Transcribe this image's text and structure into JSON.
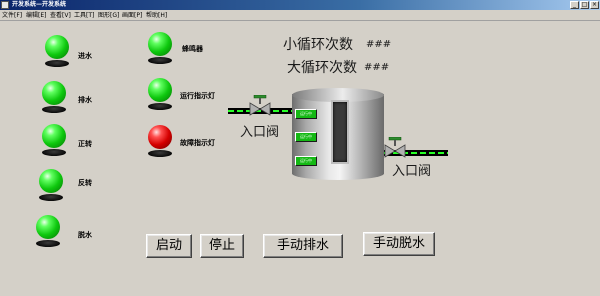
{
  "window": {
    "title": "开发系统—开发系统"
  },
  "menu": [
    "文件[F]",
    "编辑[E]",
    "查看[V]",
    "工具[T]",
    "图形[G]",
    "画面[P]",
    "帮助[H]"
  ],
  "counters": {
    "small_cycle_label": "小循环次数",
    "small_cycle_value": "###",
    "large_cycle_label": "大循环次数",
    "large_cycle_value": "###"
  },
  "lamps_left": [
    {
      "label": "进水",
      "color": "green"
    },
    {
      "label": "排水",
      "color": "green"
    },
    {
      "label": "正转",
      "color": "green"
    },
    {
      "label": "反转",
      "color": "green"
    },
    {
      "label": "脱水",
      "color": "green"
    }
  ],
  "lamps_right": [
    {
      "label": "蜂鸣器",
      "color": "green"
    },
    {
      "label": "运行指示灯",
      "color": "green"
    },
    {
      "label": "故障指示灯",
      "color": "red"
    }
  ],
  "valves": {
    "inlet_label": "入口阀",
    "outlet_label": "入口阀"
  },
  "tank_indicators": [
    "运行中",
    "运行中",
    "运行中"
  ],
  "buttons": {
    "start": "启动",
    "stop": "停止",
    "manual_drain": "手动排水",
    "manual_spin": "手动脱水"
  },
  "colors": {
    "lamp_on": "#0ec80e",
    "lamp_fault": "#d40000",
    "pipe_flow": "#27ff27",
    "background": "#d4d0c8"
  }
}
